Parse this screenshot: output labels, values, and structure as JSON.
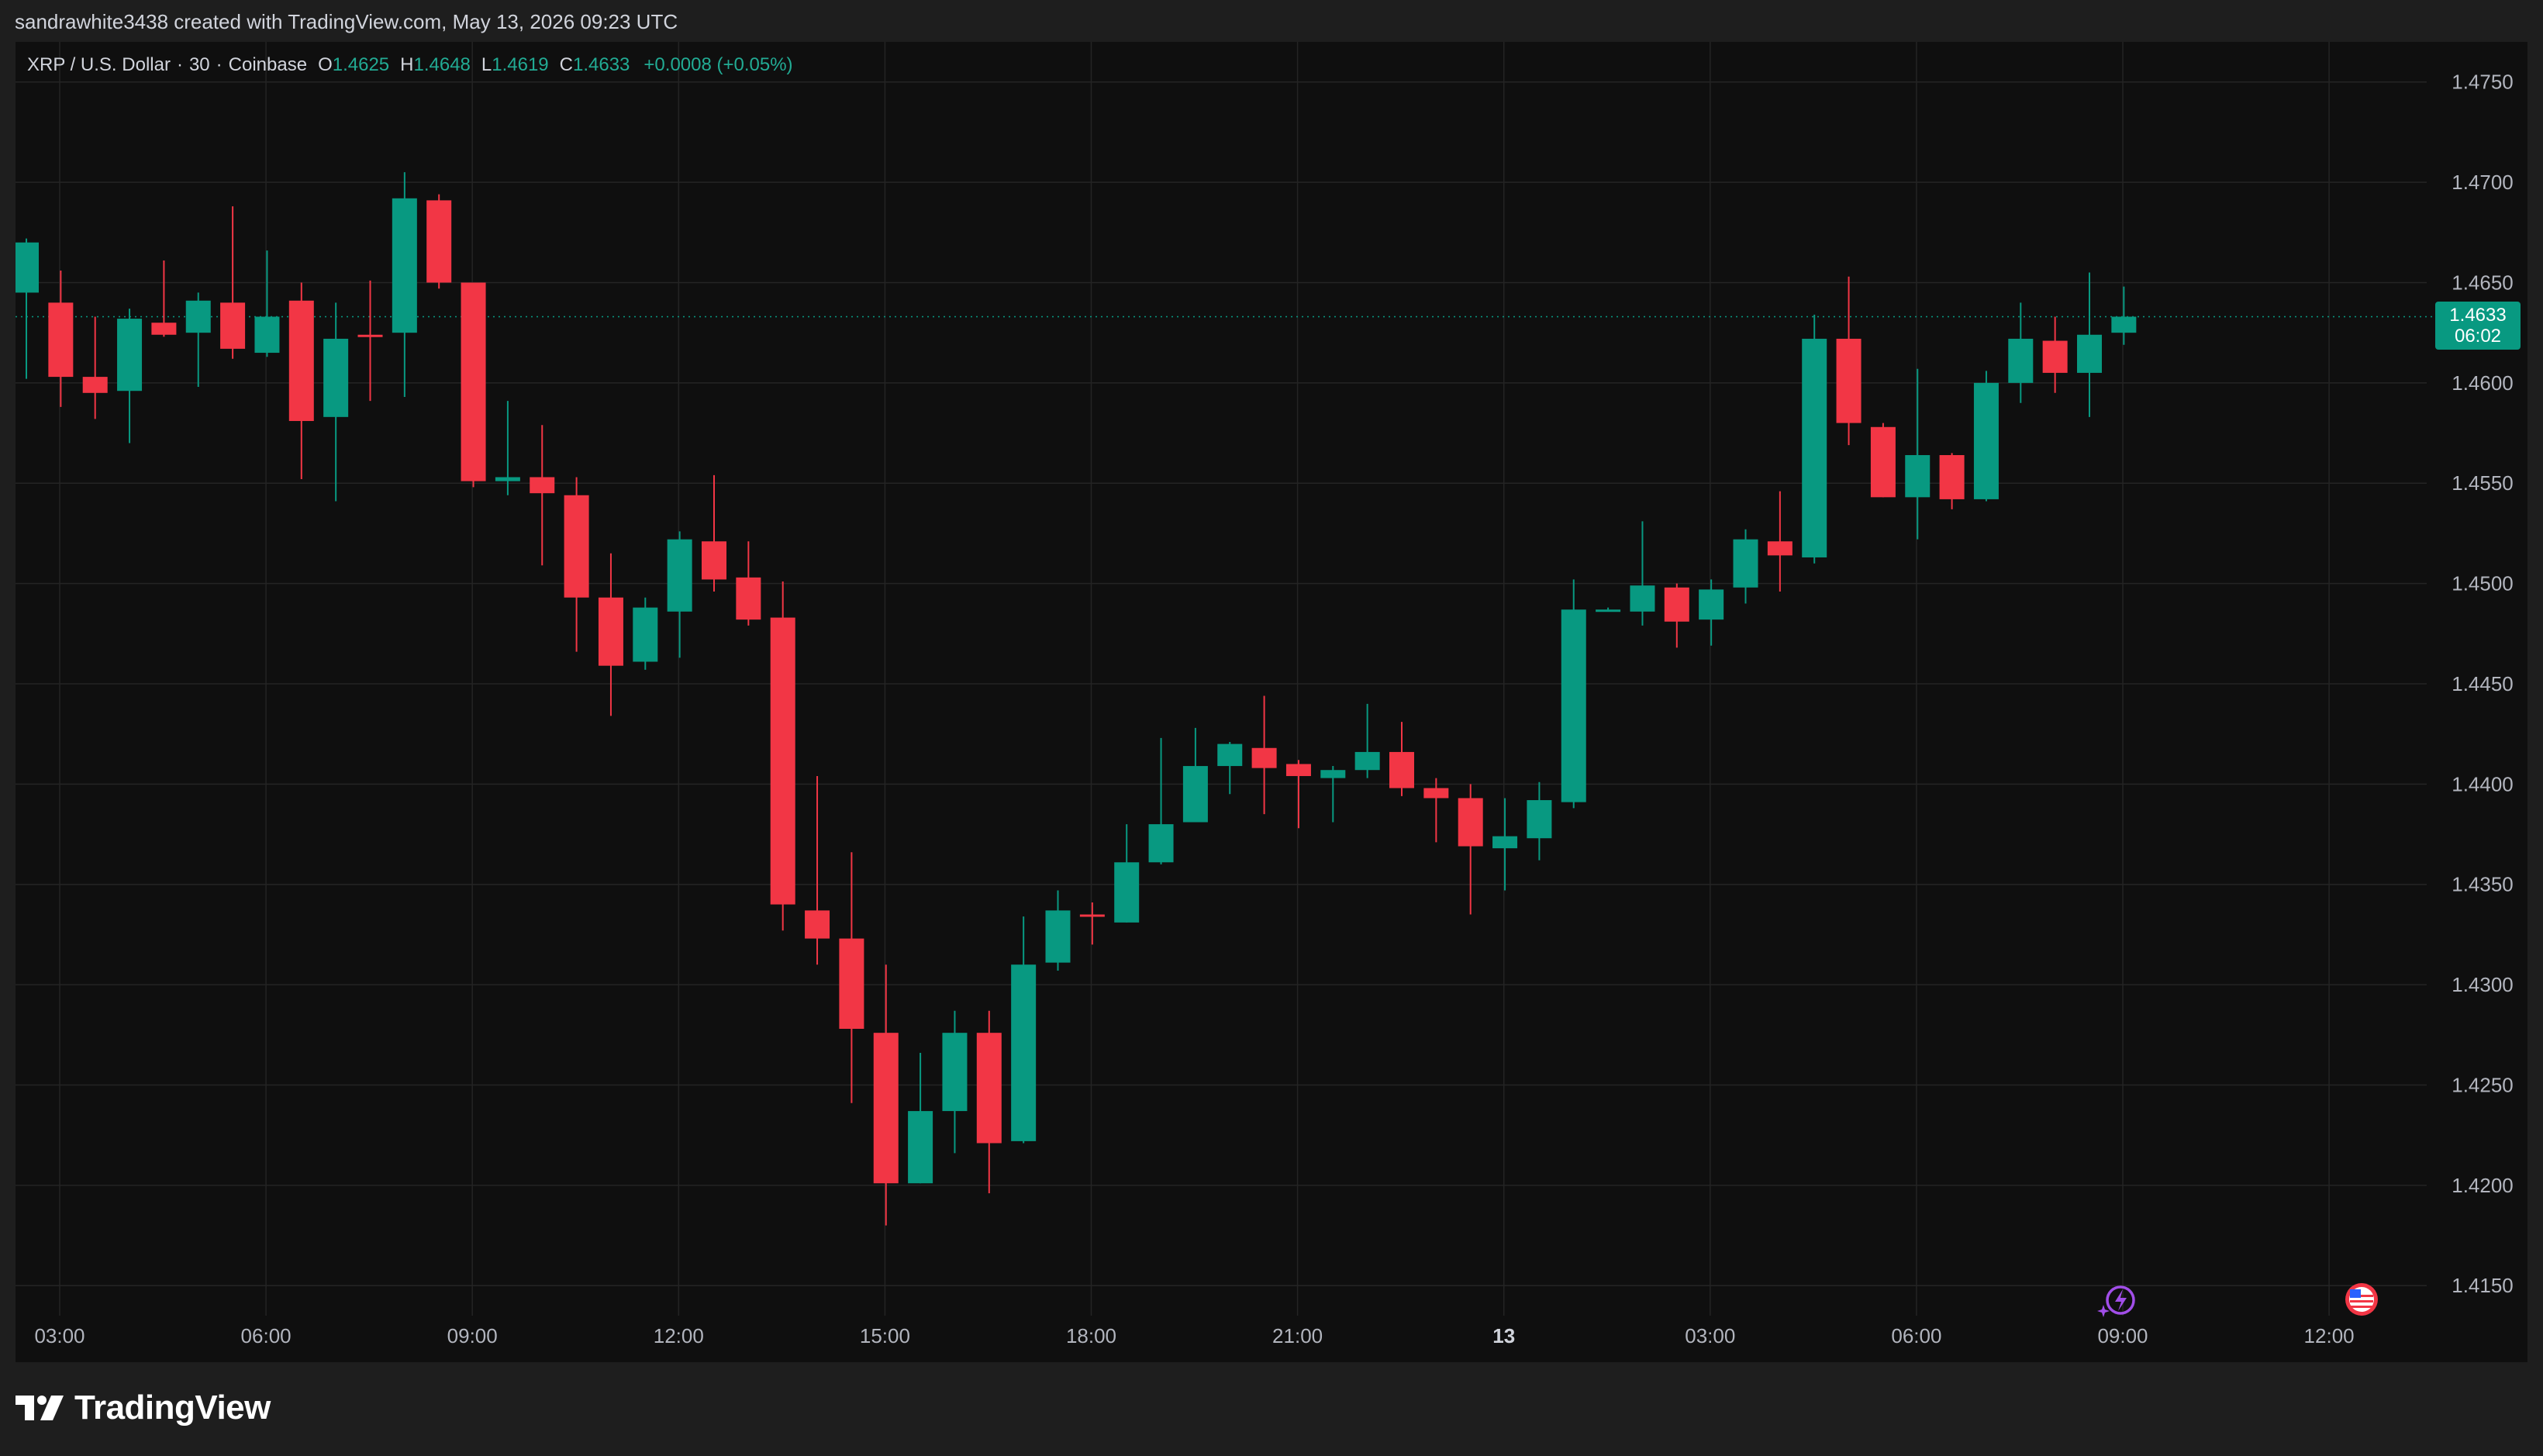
{
  "header": {
    "credit": "sandrawhite3438 created with TradingView.com, May 13, 2026 09:23 UTC"
  },
  "legend": {
    "symbol": "XRP / U.S. Dollar",
    "interval": "30",
    "exchange": "Coinbase",
    "open_label": "O",
    "open_value": "1.4625",
    "high_label": "H",
    "high_value": "1.4648",
    "low_label": "L",
    "low_value": "1.4619",
    "close_label": "C",
    "close_value": "1.4633",
    "change": "+0.0008 (+0.05%)",
    "separator": "·"
  },
  "price_tag": {
    "price": "1.4633",
    "countdown": "06:02"
  },
  "brand": {
    "logo_text": "TradingView"
  },
  "colors": {
    "up": "#089981",
    "down": "#f23645",
    "background": "#0f0f0f",
    "grid": "#242424",
    "axis_text": "#b2b5be"
  },
  "icons": [
    "tradingview-logo-icon",
    "lightning-sparkle-icon",
    "us-flag-icon"
  ],
  "chart_data": {
    "type": "candlestick",
    "x_ticks": [
      "03:00",
      "06:00",
      "09:00",
      "12:00",
      "15:00",
      "18:00",
      "21:00",
      "13",
      "03:00",
      "06:00",
      "09:00",
      "12:00"
    ],
    "x_ticks_bold": [
      "13"
    ],
    "y_ticks": [
      "1.4750",
      "1.4700",
      "1.4650",
      "1.4600",
      "1.4550",
      "1.4500",
      "1.4450",
      "1.4400",
      "1.4350",
      "1.4300",
      "1.4250",
      "1.4200",
      "1.4150"
    ],
    "ylim": [
      1.4135,
      1.477
    ],
    "last_price": 1.4633,
    "grid": true,
    "candles": [
      {
        "o": 1.4645,
        "h": 1.4672,
        "l": 1.4602,
        "c": 1.467
      },
      {
        "o": 1.464,
        "h": 1.4656,
        "l": 1.4588,
        "c": 1.4603
      },
      {
        "o": 1.4603,
        "h": 1.4633,
        "l": 1.4582,
        "c": 1.4595
      },
      {
        "o": 1.4596,
        "h": 1.4637,
        "l": 1.457,
        "c": 1.4632
      },
      {
        "o": 1.463,
        "h": 1.4661,
        "l": 1.4623,
        "c": 1.4624
      },
      {
        "o": 1.4625,
        "h": 1.4645,
        "l": 1.4598,
        "c": 1.4641
      },
      {
        "o": 1.464,
        "h": 1.4688,
        "l": 1.4612,
        "c": 1.4617
      },
      {
        "o": 1.4615,
        "h": 1.4666,
        "l": 1.4613,
        "c": 1.4633
      },
      {
        "o": 1.4641,
        "h": 1.465,
        "l": 1.4552,
        "c": 1.4581
      },
      {
        "o": 1.4583,
        "h": 1.464,
        "l": 1.4541,
        "c": 1.4622
      },
      {
        "o": 1.4624,
        "h": 1.4651,
        "l": 1.4591,
        "c": 1.4623
      },
      {
        "o": 1.4625,
        "h": 1.4705,
        "l": 1.4593,
        "c": 1.4692
      },
      {
        "o": 1.4691,
        "h": 1.4694,
        "l": 1.4647,
        "c": 1.465
      },
      {
        "o": 1.465,
        "h": 1.465,
        "l": 1.4548,
        "c": 1.4551
      },
      {
        "o": 1.4551,
        "h": 1.4591,
        "l": 1.4544,
        "c": 1.4553
      },
      {
        "o": 1.4553,
        "h": 1.4579,
        "l": 1.4509,
        "c": 1.4545
      },
      {
        "o": 1.4544,
        "h": 1.4553,
        "l": 1.4466,
        "c": 1.4493
      },
      {
        "o": 1.4493,
        "h": 1.4515,
        "l": 1.4434,
        "c": 1.4459
      },
      {
        "o": 1.4461,
        "h": 1.4493,
        "l": 1.4457,
        "c": 1.4488
      },
      {
        "o": 1.4486,
        "h": 1.4526,
        "l": 1.4463,
        "c": 1.4522
      },
      {
        "o": 1.4521,
        "h": 1.4554,
        "l": 1.4496,
        "c": 1.4502
      },
      {
        "o": 1.4503,
        "h": 1.4521,
        "l": 1.4479,
        "c": 1.4482
      },
      {
        "o": 1.4483,
        "h": 1.4501,
        "l": 1.4327,
        "c": 1.434
      },
      {
        "o": 1.4337,
        "h": 1.4404,
        "l": 1.431,
        "c": 1.4323
      },
      {
        "o": 1.4323,
        "h": 1.4366,
        "l": 1.4241,
        "c": 1.4278
      },
      {
        "o": 1.4276,
        "h": 1.431,
        "l": 1.418,
        "c": 1.4201
      },
      {
        "o": 1.4201,
        "h": 1.4266,
        "l": 1.4201,
        "c": 1.4237
      },
      {
        "o": 1.4237,
        "h": 1.4287,
        "l": 1.4216,
        "c": 1.4276
      },
      {
        "o": 1.4276,
        "h": 1.4287,
        "l": 1.4196,
        "c": 1.4221
      },
      {
        "o": 1.4222,
        "h": 1.4334,
        "l": 1.4221,
        "c": 1.431
      },
      {
        "o": 1.4311,
        "h": 1.4347,
        "l": 1.4307,
        "c": 1.4337
      },
      {
        "o": 1.4335,
        "h": 1.4341,
        "l": 1.432,
        "c": 1.4334
      },
      {
        "o": 1.4331,
        "h": 1.438,
        "l": 1.4331,
        "c": 1.4361
      },
      {
        "o": 1.4361,
        "h": 1.4423,
        "l": 1.436,
        "c": 1.438
      },
      {
        "o": 1.4381,
        "h": 1.4428,
        "l": 1.4381,
        "c": 1.4409
      },
      {
        "o": 1.4409,
        "h": 1.4421,
        "l": 1.4395,
        "c": 1.442
      },
      {
        "o": 1.4418,
        "h": 1.4444,
        "l": 1.4385,
        "c": 1.4408
      },
      {
        "o": 1.441,
        "h": 1.4412,
        "l": 1.4378,
        "c": 1.4404
      },
      {
        "o": 1.4403,
        "h": 1.4409,
        "l": 1.4381,
        "c": 1.4407
      },
      {
        "o": 1.4407,
        "h": 1.444,
        "l": 1.4403,
        "c": 1.4416
      },
      {
        "o": 1.4416,
        "h": 1.4431,
        "l": 1.4394,
        "c": 1.4398
      },
      {
        "o": 1.4398,
        "h": 1.4403,
        "l": 1.4371,
        "c": 1.4393
      },
      {
        "o": 1.4393,
        "h": 1.44,
        "l": 1.4335,
        "c": 1.4369
      },
      {
        "o": 1.4368,
        "h": 1.4393,
        "l": 1.4347,
        "c": 1.4374
      },
      {
        "o": 1.4373,
        "h": 1.4401,
        "l": 1.4362,
        "c": 1.4392
      },
      {
        "o": 1.4391,
        "h": 1.4502,
        "l": 1.4388,
        "c": 1.4487
      },
      {
        "o": 1.4487,
        "h": 1.4488,
        "l": 1.4486,
        "c": 1.4487
      },
      {
        "o": 1.4486,
        "h": 1.4531,
        "l": 1.4479,
        "c": 1.4499
      },
      {
        "o": 1.4498,
        "h": 1.45,
        "l": 1.4468,
        "c": 1.4481
      },
      {
        "o": 1.4482,
        "h": 1.4502,
        "l": 1.4469,
        "c": 1.4497
      },
      {
        "o": 1.4498,
        "h": 1.4527,
        "l": 1.449,
        "c": 1.4522
      },
      {
        "o": 1.4521,
        "h": 1.4546,
        "l": 1.4496,
        "c": 1.4514
      },
      {
        "o": 1.4513,
        "h": 1.4634,
        "l": 1.451,
        "c": 1.4622
      },
      {
        "o": 1.4622,
        "h": 1.4653,
        "l": 1.4569,
        "c": 1.458
      },
      {
        "o": 1.4578,
        "h": 1.458,
        "l": 1.4543,
        "c": 1.4543
      },
      {
        "o": 1.4543,
        "h": 1.4607,
        "l": 1.4522,
        "c": 1.4564
      },
      {
        "o": 1.4564,
        "h": 1.4565,
        "l": 1.4537,
        "c": 1.4542
      },
      {
        "o": 1.4542,
        "h": 1.4606,
        "l": 1.4541,
        "c": 1.46
      },
      {
        "o": 1.46,
        "h": 1.464,
        "l": 1.459,
        "c": 1.4622
      },
      {
        "o": 1.4621,
        "h": 1.4633,
        "l": 1.4595,
        "c": 1.4605
      },
      {
        "o": 1.4605,
        "h": 1.4655,
        "l": 1.4583,
        "c": 1.4624
      },
      {
        "o": 1.4625,
        "h": 1.4648,
        "l": 1.4619,
        "c": 1.4633
      }
    ]
  }
}
